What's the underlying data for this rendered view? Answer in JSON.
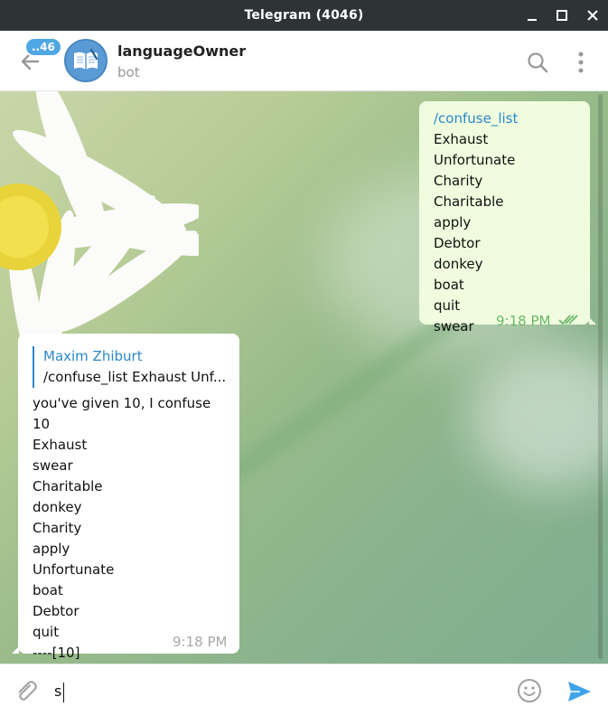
{
  "window": {
    "title": "Telegram (4046)"
  },
  "header": {
    "unread_badge": "..46",
    "chat_name": "languageOwner",
    "chat_status": "bot"
  },
  "messages": {
    "outgoing": {
      "command": "/confuse_list",
      "first_word": " Exhaust",
      "lines": [
        "Unfortunate",
        "Charity",
        "Charitable",
        "apply",
        "Debtor",
        "donkey",
        "boat",
        "quit",
        "swear"
      ],
      "time": "9:18 PM",
      "status": "read"
    },
    "incoming": {
      "reply_author": "Maxim Zhiburt",
      "reply_preview": "/confuse_list Exhaust Unf...",
      "lines": [
        "you've given 10, I confuse 10",
        "Exhaust",
        "swear",
        "Charitable",
        "donkey",
        "Charity",
        "apply",
        "Unfortunate",
        "boat",
        "Debtor",
        "quit",
        "----[10]"
      ],
      "time": "9:18 PM"
    }
  },
  "composer": {
    "input_value": "s"
  },
  "colors": {
    "accent": "#2a88c8",
    "outgoing_bubble": "#effdde",
    "badge": "#4fa7e3",
    "send": "#3fa3e8"
  },
  "icons": [
    "back-arrow-icon",
    "bot-book-avatar",
    "search-icon",
    "more-vertical-icon",
    "double-check-icon",
    "paperclip-icon",
    "smiley-icon",
    "send-icon",
    "minimize-icon",
    "maximize-icon",
    "close-icon"
  ]
}
